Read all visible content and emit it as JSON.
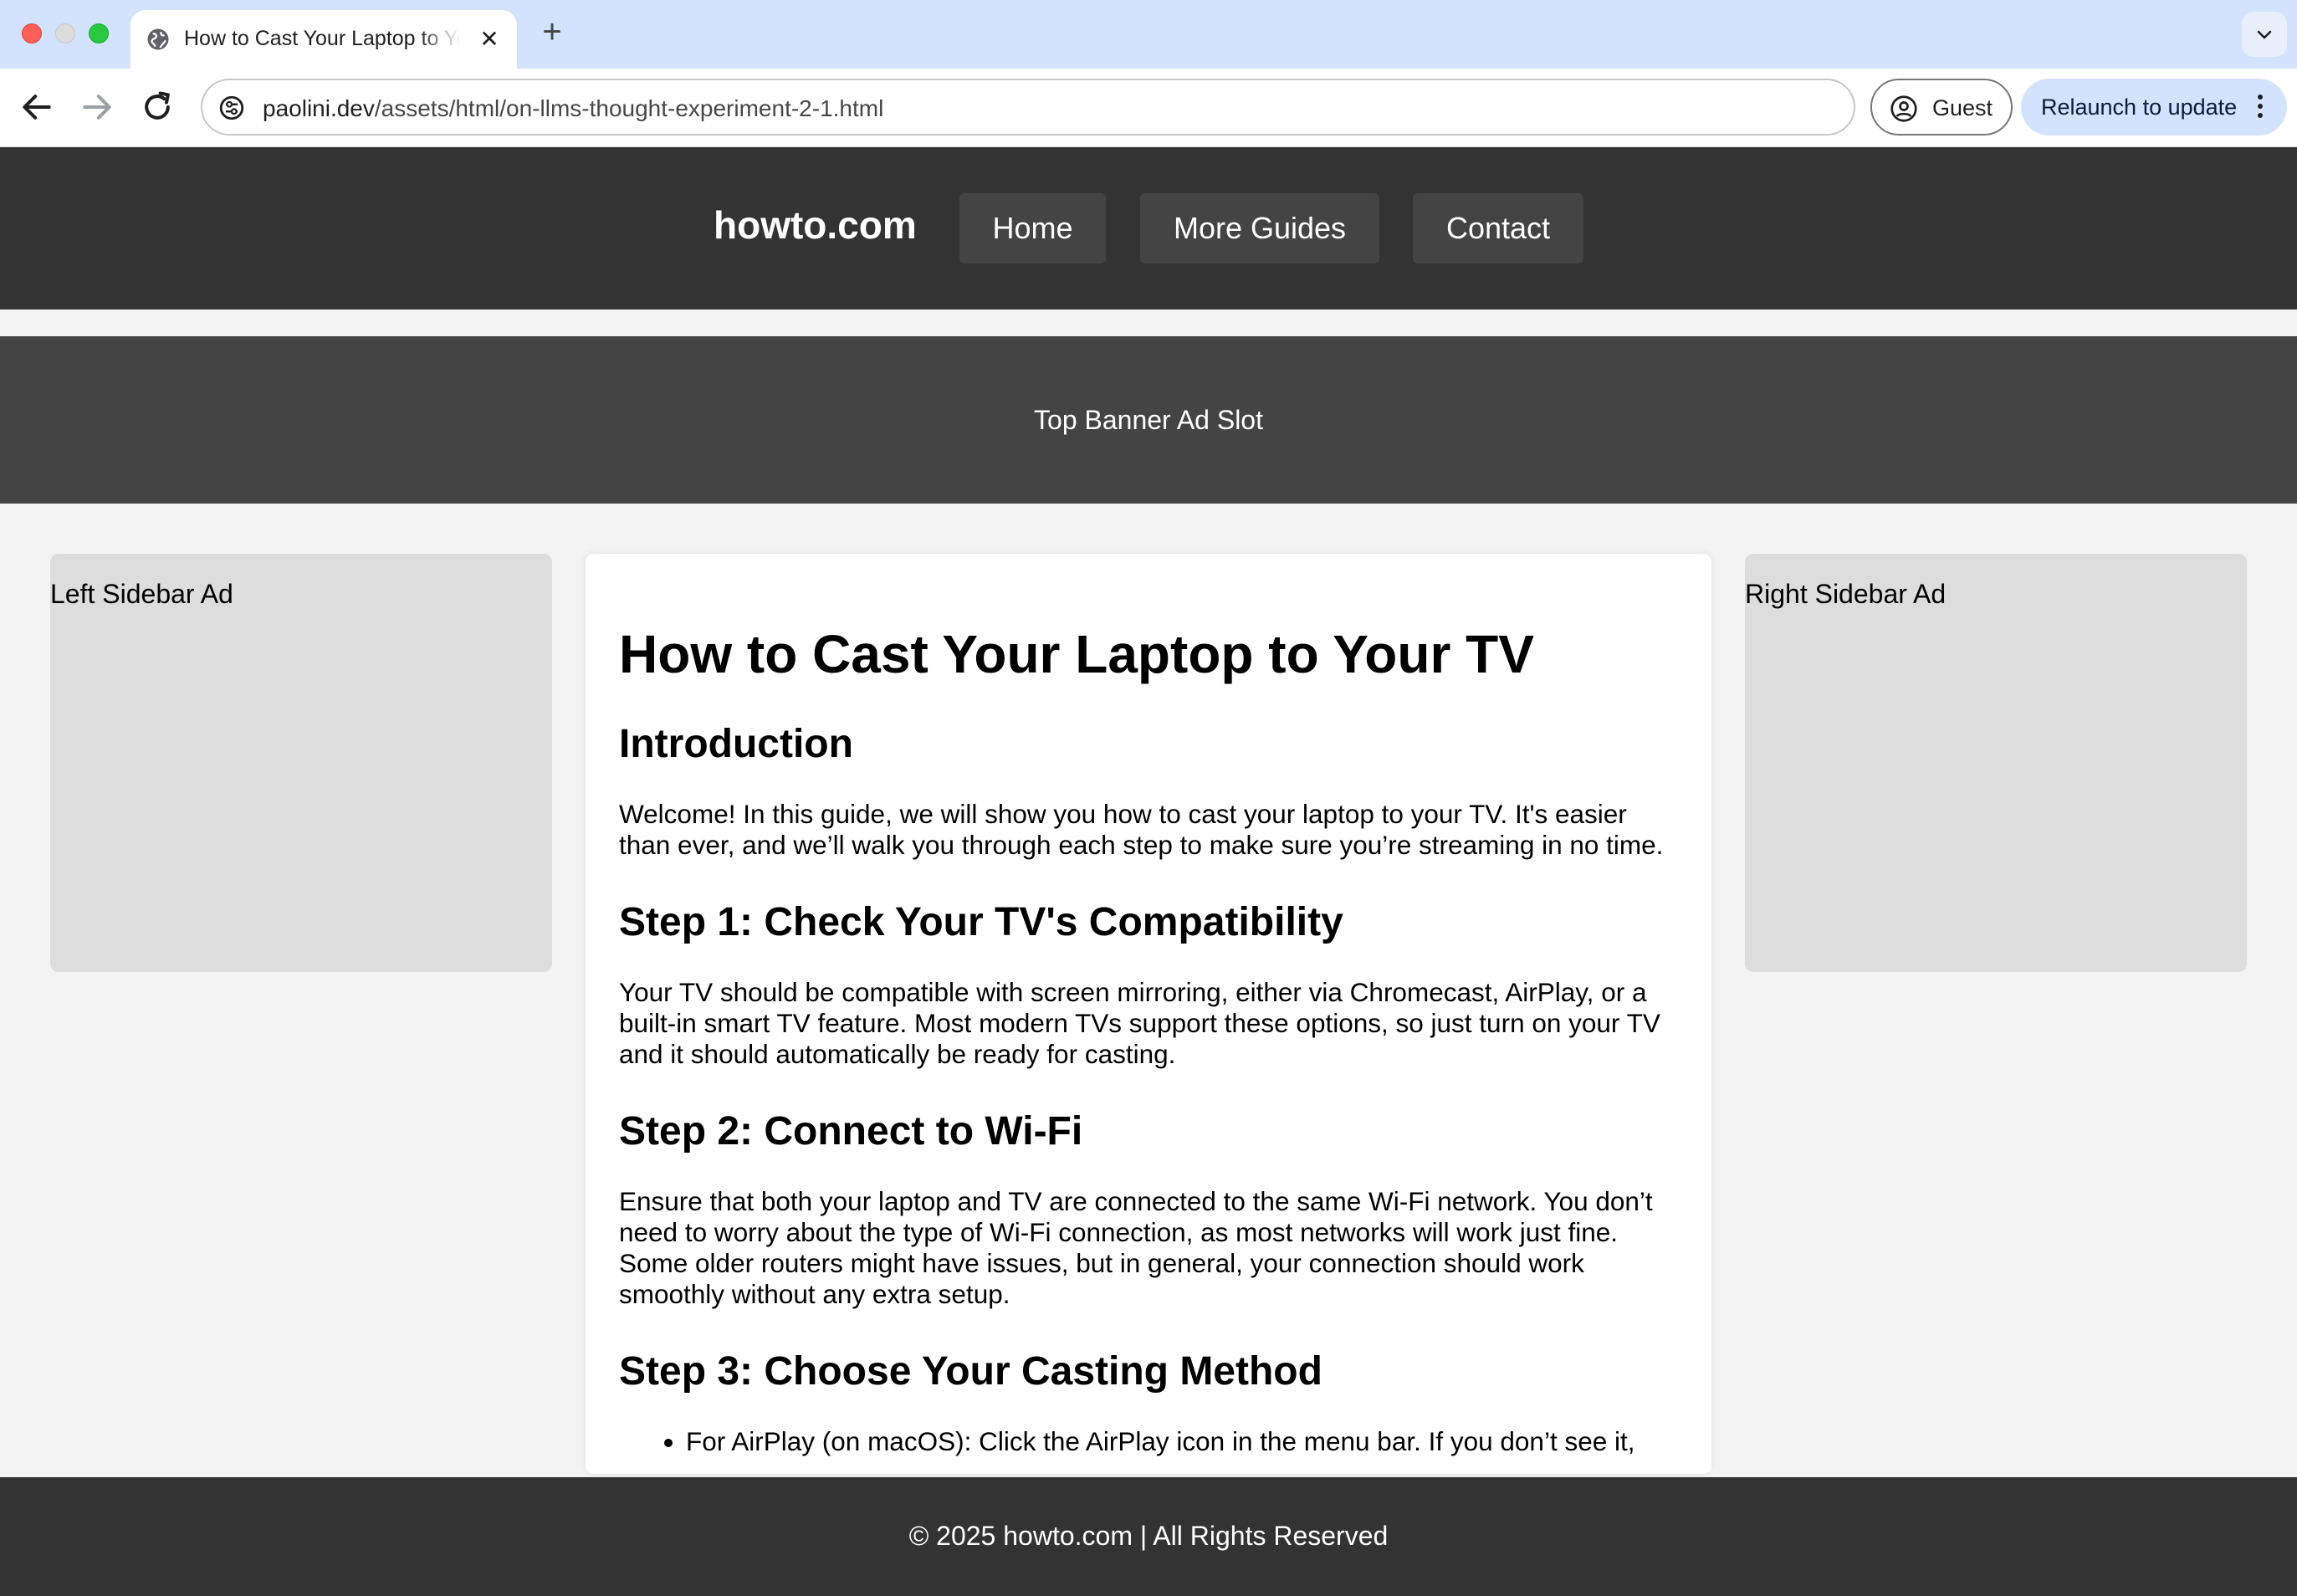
{
  "browser": {
    "tab_title": "How to Cast Your Laptop to Your TV",
    "tab_close": "✕",
    "new_tab": "+",
    "url_domain": "paolini.dev",
    "url_path": "/assets/html/on-llms-thought-experiment-2-1.html",
    "guest_label": "Guest",
    "relaunch_label": "Relaunch to update"
  },
  "site": {
    "brand": "howto.com",
    "nav": [
      "Home",
      "More Guides",
      "Contact"
    ],
    "top_banner": "Top Banner Ad Slot",
    "left_ad": "Left Sidebar Ad",
    "right_ad": "Right Sidebar Ad",
    "footer": "© 2025 howto.com | All Rights Reserved"
  },
  "article": {
    "title": "How to Cast Your Laptop to Your TV",
    "sections": [
      {
        "heading": "Introduction",
        "text": "Welcome! In this guide, we will show you how to cast your laptop to your TV. It's easier than ever, and we’ll walk you through each step to make sure you’re streaming in no time."
      },
      {
        "heading": "Step 1: Check Your TV's Compatibility",
        "text": "Your TV should be compatible with screen mirroring, either via Chromecast, AirPlay, or a built-in smart TV feature. Most modern TVs support these options, so just turn on your TV and it should automatically be ready for casting."
      },
      {
        "heading": "Step 2: Connect to Wi-Fi",
        "text": "Ensure that both your laptop and TV are connected to the same Wi-Fi network. You don’t need to worry about the type of Wi-Fi connection, as most networks will work just fine. Some older routers might have issues, but in general, your connection should work smoothly without any extra setup."
      },
      {
        "heading": "Step 3: Choose Your Casting Method",
        "list": [
          "For AirPlay (on macOS): Click the AirPlay icon in the menu bar. If you don’t see it,"
        ]
      }
    ]
  },
  "icons": {
    "favicon": "globe-icon",
    "back": "arrow-left-icon",
    "forward": "arrow-right-icon",
    "reload": "reload-icon",
    "site_info": "tune-icon",
    "profile": "person-circle-icon",
    "menu": "kebab-icon",
    "tab_search": "chevron-down-icon"
  },
  "colors": {
    "header_bg": "#333333",
    "nav_button_bg": "#444444",
    "banner_bg": "#444444",
    "sidebar_ad_bg": "#dddddd",
    "page_bg": "#f3f3f3",
    "tabstrip_bg": "#d3e3fd"
  }
}
